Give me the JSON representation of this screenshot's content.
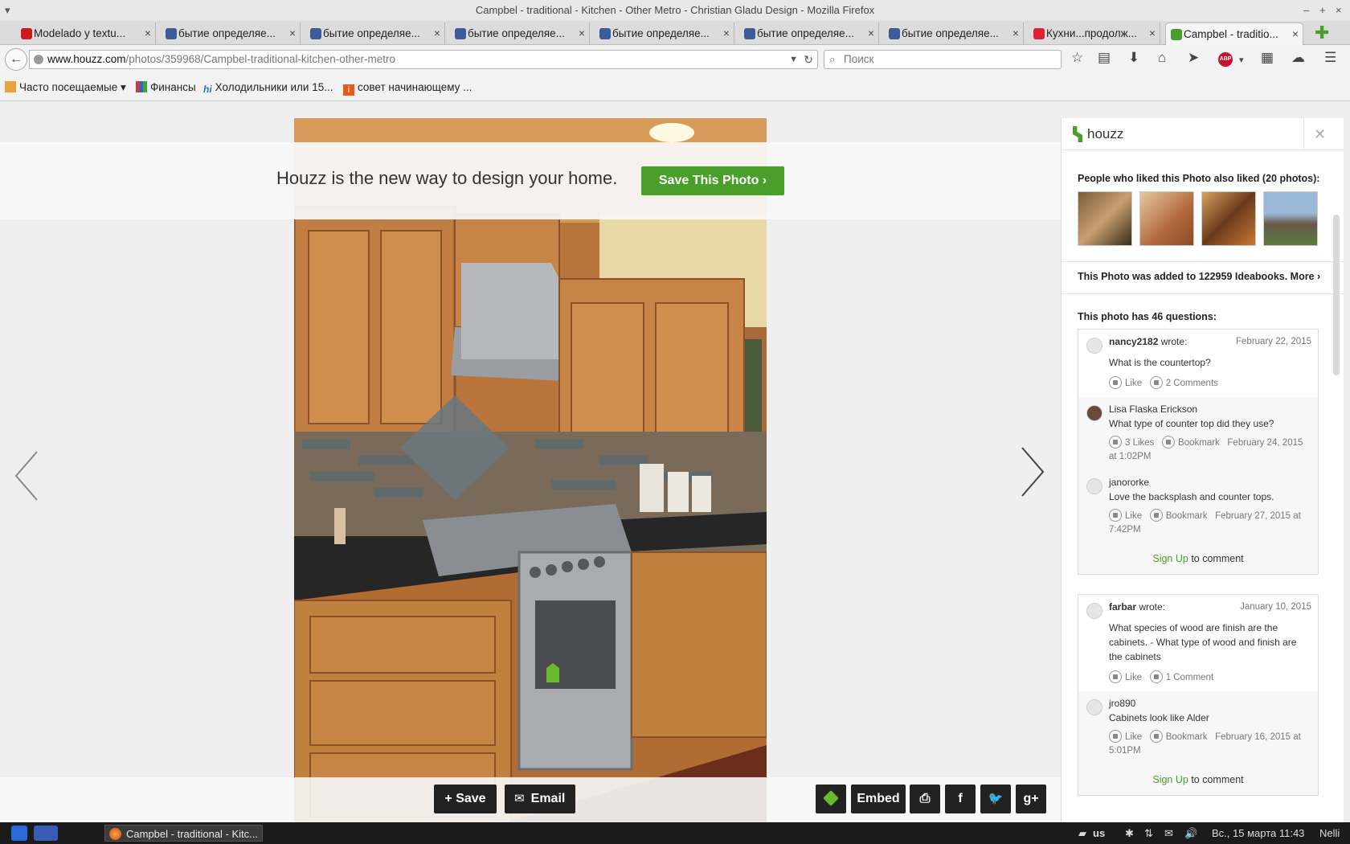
{
  "window": {
    "title": "Campbel - traditional - Kitchen - Other Metro - Christian Gladu Design - Mozilla Firefox",
    "menu_icon": "triangle-menu-icon",
    "min": "–",
    "max": "+",
    "close": "×"
  },
  "tabs": [
    {
      "label": "Modelado y textu...",
      "icon": "youtube-icon",
      "color": "#cc181e"
    },
    {
      "label": "бытие определяе...",
      "icon": "user-icon",
      "color": "#3b5b99"
    },
    {
      "label": "бытие определяе...",
      "icon": "user-icon",
      "color": "#3b5b99"
    },
    {
      "label": "бытие определяе...",
      "icon": "user-icon",
      "color": "#3b5b99"
    },
    {
      "label": "бытие определяе...",
      "icon": "user-icon",
      "color": "#3b5b99"
    },
    {
      "label": "бытие определяе...",
      "icon": "user-icon",
      "color": "#3b5b99"
    },
    {
      "label": "бытие определяе...",
      "icon": "user-icon",
      "color": "#3b5b99"
    },
    {
      "label": "Кухни...продолж...",
      "icon": "forum-icon",
      "color": "#d23"
    },
    {
      "label": "Campbel - traditio...",
      "icon": "houzz-icon",
      "color": "#4a9e2a"
    }
  ],
  "tab_close": "×",
  "url": {
    "domain": "www.houzz.com",
    "path": "/photos/359968/Campbel-traditional-kitchen-other-metro"
  },
  "search_placeholder": "Поиск",
  "bookmarks": [
    "Часто посещаемые ▾",
    "Финансы",
    "Холодильники или 15...",
    "совет начинающему ..."
  ],
  "banner": {
    "text": "Houzz is the new way to design your home.",
    "button": "Save This Photo ›"
  },
  "bottom_buttons": {
    "save": "+ Save",
    "email": "Email",
    "embed": "Embed",
    "facebook": "f",
    "gplus": "g+"
  },
  "panel": {
    "logo": "houzz",
    "close": "✕",
    "also_liked": "People who liked this Photo also liked (20 photos):",
    "added_prefix": "This Photo was added to ",
    "added_count": "122959",
    "added_suffix": " Ideabooks.",
    "more": " More ›",
    "questions_prefix": "This photo has ",
    "questions_count": "46",
    "questions_suffix": " questions:",
    "threads": [
      {
        "question": {
          "user": "nancy2182",
          "wrote": " wrote:",
          "date": "February 22, 2015",
          "text": "What is the countertop?",
          "like": "Like",
          "comments": "2 Comments"
        },
        "replies": [
          {
            "user": "Lisa Flaska Erickson",
            "text": "What type of counter top did they use?",
            "likes": "3 Likes",
            "bookmark": "Bookmark",
            "date": "February 24, 2015 at 1:02PM"
          },
          {
            "user": "janororke",
            "text": "Love the backsplash and counter tops.",
            "likes": "Like",
            "bookmark": "Bookmark",
            "date": "February 27, 2015 at 7:42PM"
          }
        ]
      },
      {
        "question": {
          "user": "farbar",
          "wrote": " wrote:",
          "date": "January 10, 2015",
          "text": "What species of wood are finish are the cabinets. - What type of wood and finish are the cabinets",
          "like": "Like",
          "comments": "1 Comment"
        },
        "replies": [
          {
            "user": "jro890",
            "text": "Cabinets look like Alder",
            "likes": "Like",
            "bookmark": "Bookmark",
            "date": "February 16, 2015 at 5:01PM"
          }
        ]
      }
    ],
    "signup": "Sign Up",
    "to_comment": " to comment"
  },
  "taskbar": {
    "window": "Campbel - traditional - Kitc...",
    "lang": "us",
    "datetime": "Вс., 15 марта 11:43",
    "user": "Nelli"
  }
}
